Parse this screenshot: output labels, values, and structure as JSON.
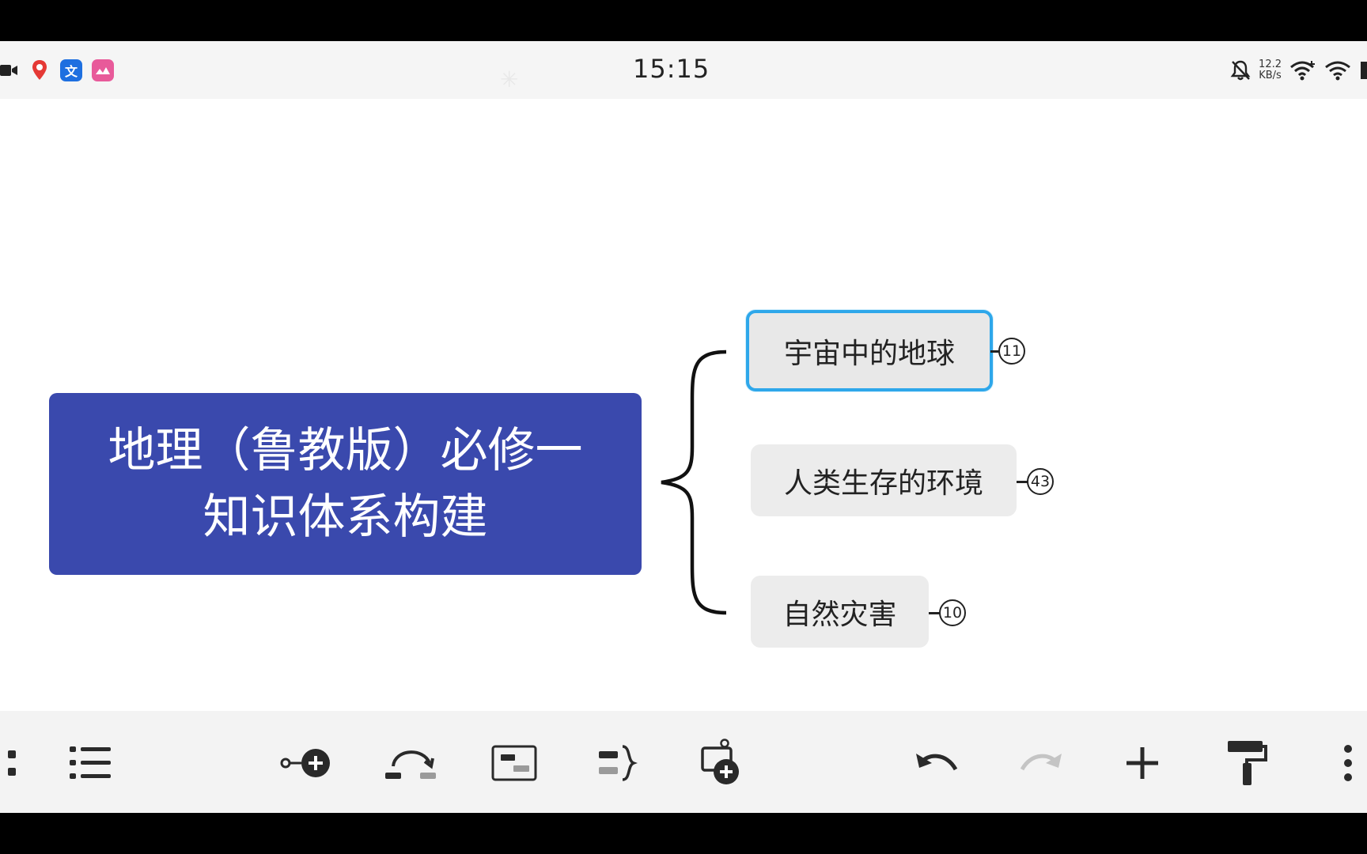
{
  "status_bar": {
    "time": "15:15",
    "net_speed_value": "12.2",
    "net_speed_unit": "KB/s",
    "left_icons": [
      "video-camera-icon",
      "location-pin-icon",
      "translate-app-icon",
      "photo-app-icon"
    ],
    "right_icons": [
      "bell-muted-icon",
      "wifi-plus-icon",
      "wifi-icon",
      "battery-icon"
    ]
  },
  "mindmap": {
    "root": {
      "title": "地理（鲁教版）必修一\n知识体系构建"
    },
    "topics": [
      {
        "label": "宇宙中的地球",
        "count": "11",
        "selected": true
      },
      {
        "label": "人类生存的环境",
        "count": "43",
        "selected": false
      },
      {
        "label": "自然灾害",
        "count": "10",
        "selected": false
      }
    ]
  },
  "toolbar": {
    "buttons": [
      "structure-icon",
      "outline-list-icon",
      "add-subtopic-icon",
      "relationship-icon",
      "summary-box-icon",
      "boundary-bracket-icon",
      "insert-floating-topic-icon",
      "undo-icon",
      "redo-icon",
      "add-icon",
      "format-painter-icon",
      "more-menu-icon"
    ]
  },
  "colors": {
    "root_fill": "#3a49ad",
    "topic_fill": "#ececec",
    "selection_border": "#2ea7ea",
    "toolbar_bg": "#f3f3f3"
  }
}
